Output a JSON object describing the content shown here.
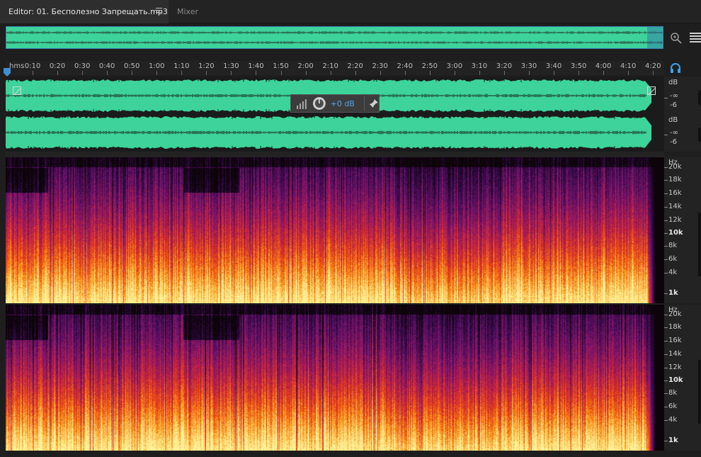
{
  "tabs": {
    "editor": "Editor: 01. Бесполезно Запрещать.mp3",
    "mixer": "Mixer"
  },
  "icons": {
    "tab_menu": "hamburger-icon",
    "zoom": "zoom-icon",
    "panel_menu": "list-menu-icon",
    "playhead": "playhead-marker-icon",
    "headphones": "headphones-icon",
    "level_meter": "level-meter-icon",
    "volume_knob": "volume-knob-icon",
    "pin": "pin-icon"
  },
  "ruler": {
    "unit_label": "hms",
    "labels": [
      "0:10",
      "0:20",
      "0:30",
      "0:40",
      "0:50",
      "1:00",
      "1:10",
      "1:20",
      "1:30",
      "1:40",
      "1:50",
      "2:00",
      "2:10",
      "2:20",
      "2:30",
      "2:40",
      "2:50",
      "3:00",
      "3:10",
      "3:20",
      "3:30",
      "3:40",
      "3:50",
      "4:00",
      "4:10",
      "4:20"
    ]
  },
  "waveform": {
    "channel_1": {
      "db_label": "dB",
      "levels": [
        "-∞",
        "-6"
      ]
    },
    "channel_2": {
      "db_label": "dB",
      "levels": [
        "-∞",
        "-6"
      ]
    }
  },
  "hud": {
    "gain": "+0 dB"
  },
  "spectral": {
    "channel_1": {
      "unit": "Hz",
      "labels": [
        "20k",
        "18k",
        "16k",
        "14k",
        "12k",
        "10k",
        "8k",
        "6k",
        "4k",
        "1k"
      ]
    },
    "channel_2": {
      "unit": "Hz",
      "labels": [
        "20k",
        "18k",
        "16k",
        "14k",
        "12k",
        "10k",
        "8k",
        "6k",
        "4k",
        "1k"
      ]
    }
  },
  "colors": {
    "waveform": "#3dd39a",
    "selection_border": "#3c7fb6",
    "accent": "#4ea3e8",
    "background": "#1e1e1e"
  }
}
